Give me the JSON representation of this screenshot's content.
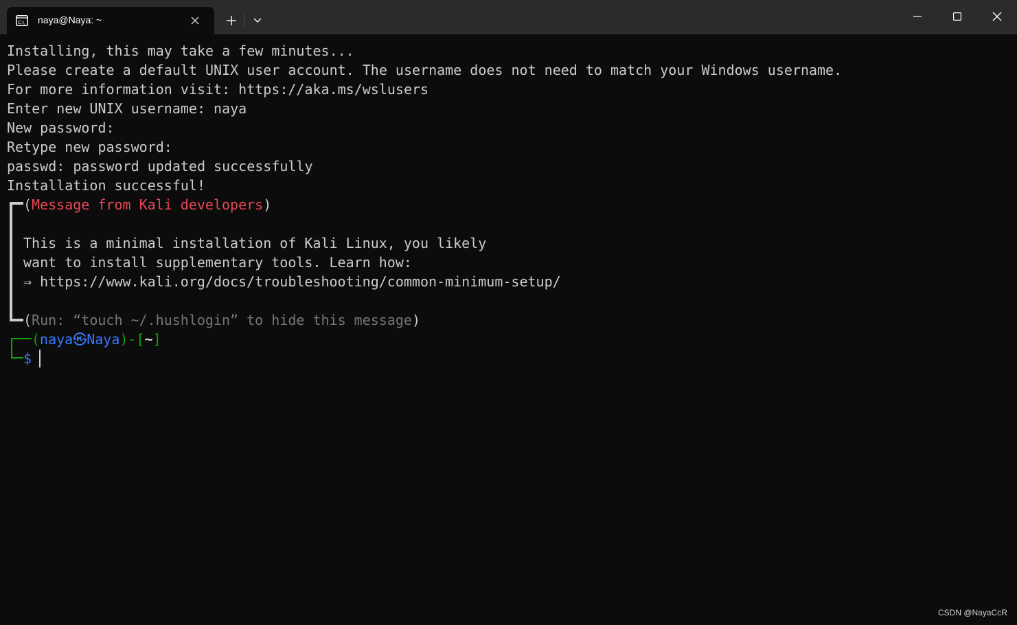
{
  "window": {
    "tab_title": "naya@Naya: ~",
    "tab_icon": "terminal-icon",
    "new_tab_icon": "plus-icon",
    "dropdown_icon": "chevron-down-icon",
    "controls": {
      "minimize_icon": "minimize-icon",
      "maximize_icon": "maximize-icon",
      "close_icon": "close-icon"
    }
  },
  "terminal": {
    "colors": {
      "background": "#0c0c0c",
      "foreground": "#cccccc",
      "red": "#e74856",
      "gray": "#767676",
      "green": "#13a10e",
      "blue": "#3b78ff"
    },
    "output_lines": [
      "Installing, this may take a few minutes...",
      "Please create a default UNIX user account. The username does not need to match your Windows username.",
      "For more information visit: https://aka.ms/wslusers",
      "Enter new UNIX username: naya",
      "New password:",
      "Retype new password:",
      "passwd: password updated successfully",
      "Installation successful!"
    ],
    "message": {
      "open_paren": "(",
      "heading": "Message from Kali developers",
      "close_paren": ")",
      "body_lines": [
        "This is a minimal installation of Kali Linux, you likely",
        "want to install supplementary tools. Learn how:",
        "⇒ https://www.kali.org/docs/troubleshooting/common-minimum-setup/"
      ],
      "footer_open": "(",
      "footer": "Run: “touch ~/.hushlogin” to hide this message",
      "footer_close": ")"
    },
    "prompt": {
      "open": "(",
      "user": "naya",
      "at_symbol": "㉿",
      "host": "Naya",
      "separator": ")-[",
      "path": "~",
      "close": "]",
      "symbol": "$"
    }
  },
  "watermark": "CSDN @NayaCcR"
}
